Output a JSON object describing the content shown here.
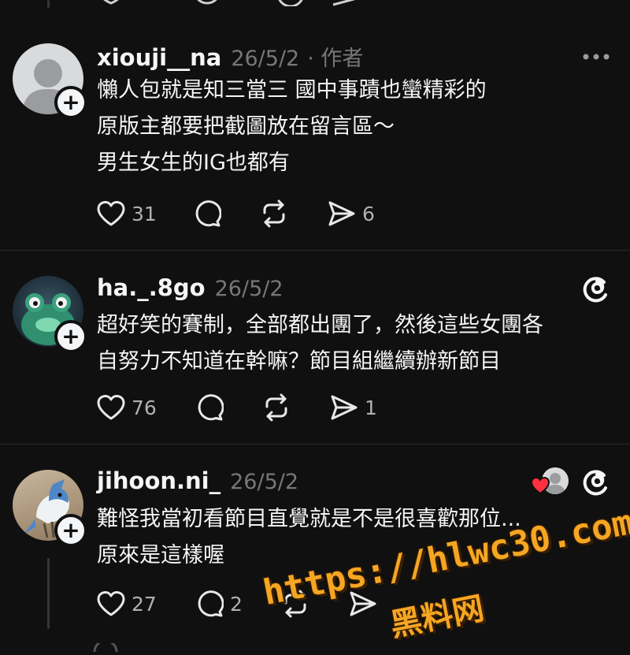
{
  "comments": [
    {
      "username": "xiouji__na",
      "date": "26/5/2",
      "author_badge": "· 作者",
      "lines": [
        "懶人包就是知三當三 國中事蹟也蠻精彩的",
        "原版主都要把截圖放在留言區～",
        "男生女生的IG也都有"
      ],
      "likes": "31",
      "replies": "",
      "shares": "6"
    },
    {
      "username": "ha._.8go",
      "date": "26/5/2",
      "lines": [
        "超好笑的賽制，全部都出團了，然後這些女團各",
        "自努力不知道在幹嘛？節目組繼續辦新節目"
      ],
      "likes": "76",
      "replies": "",
      "shares": "1"
    },
    {
      "username": "jihoon.ni_",
      "date": "26/5/2",
      "lines": [
        "難怪我當初看節目直覺就是不是很喜歡那位...",
        "原來是這樣喔"
      ],
      "likes": "27",
      "replies": "2",
      "shares": ""
    }
  ],
  "watermark": {
    "url": "https://hlwc30.com",
    "label": "黑料网"
  },
  "colors": {
    "background": "#101010",
    "text": "#f3f5f7",
    "muted": "#777777",
    "like_red": "#ff3040",
    "watermark": "#f5a623"
  },
  "icons": [
    "heart-icon",
    "comment-icon",
    "repost-icon",
    "share-icon",
    "threads-logo-icon",
    "more-icon",
    "add-follow-icon"
  ]
}
